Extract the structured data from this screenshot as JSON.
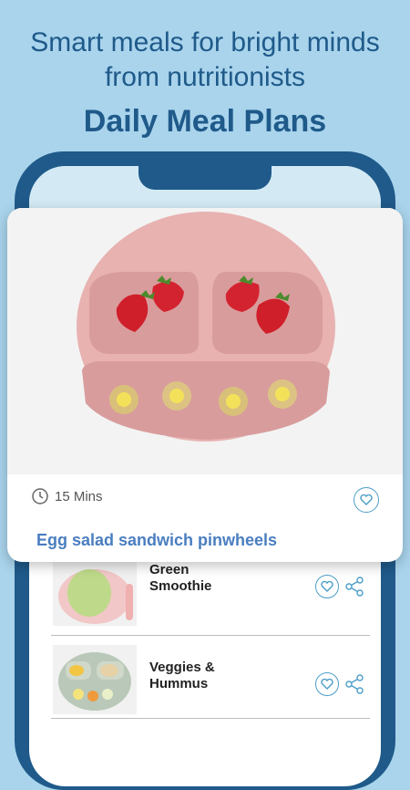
{
  "headline": {
    "line1": "Smart meals for bright minds",
    "line2": "from nutritionists",
    "title": "Daily Meal Plans"
  },
  "featured": {
    "duration": "15 Mins",
    "title": "Egg salad sandwich pinwheels",
    "icons": [
      "clock-icon",
      "heart-icon"
    ]
  },
  "list": [
    {
      "title": "Green Smoothie",
      "icons": [
        "heart-icon",
        "share-icon"
      ]
    },
    {
      "title": "Veggies & Hummus",
      "icons": [
        "heart-icon",
        "share-icon"
      ]
    }
  ],
  "colors": {
    "background": "#a9d4ec",
    "brand": "#1f5a8a",
    "accent": "#4a7ec0",
    "icon": "#4d9ec9",
    "plate": "#e9b3b3"
  }
}
